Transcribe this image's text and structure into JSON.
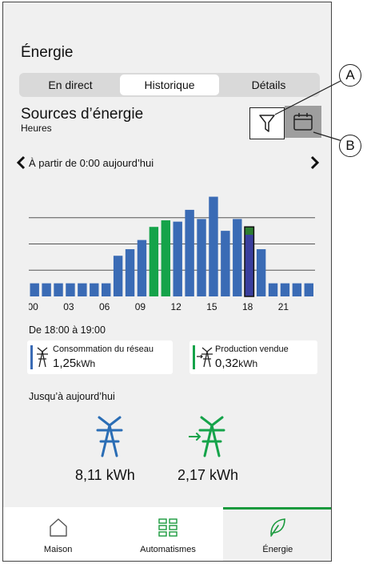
{
  "title": "Énergie",
  "tabs": [
    {
      "label": "En direct",
      "active": false
    },
    {
      "label": "Historique",
      "active": true
    },
    {
      "label": "Détails",
      "active": false
    }
  ],
  "sources": {
    "title": "Sources d’énergie",
    "subtitle": "Heures"
  },
  "toolbar": {
    "filter_icon": "filter-icon",
    "calendar_icon": "calendar-icon"
  },
  "nav": {
    "label": "À partir de 0:00 aujourd’hui"
  },
  "chart_data": {
    "type": "bar",
    "categories": [
      "00",
      "01",
      "02",
      "03",
      "04",
      "05",
      "06",
      "07",
      "08",
      "09",
      "10",
      "11",
      "12",
      "13",
      "14",
      "15",
      "16",
      "17",
      "18",
      "19",
      "20",
      "21",
      "22",
      "23"
    ],
    "tick_labels": [
      "00",
      "03",
      "06",
      "09",
      "12",
      "15",
      "18",
      "21"
    ],
    "series": [
      {
        "color": "#3a6bb5",
        "values": [
          1.0,
          1.0,
          1.0,
          1.0,
          1.0,
          1.0,
          1.0,
          3.1,
          3.6,
          4.3,
          0,
          0,
          5.7,
          6.6,
          5.9,
          7.6,
          5.0,
          5.9,
          5.3,
          3.6,
          1.0,
          1.0,
          1.0,
          1.0
        ]
      },
      {
        "color": "#15a34a",
        "values": [
          0,
          0,
          0,
          0,
          0,
          0,
          0,
          0,
          0,
          0,
          5.3,
          5.8,
          0,
          0,
          0,
          0,
          0,
          0,
          0,
          0,
          0,
          0,
          0,
          0
        ]
      }
    ],
    "highlight": {
      "index": 18,
      "top_color": "#2e7d32",
      "top_value": 0.6,
      "bottom_color": "#3a3f9e"
    },
    "ylim": [
      0,
      8
    ],
    "grid_lines": [
      2,
      4,
      6
    ],
    "grid": true
  },
  "period": "De 18:00 à 19:00",
  "cards": [
    {
      "label": "Consommation du réseau",
      "value": "1,25",
      "unit": "kWh",
      "color": "#3a6bb5",
      "icon": "grid-pylon-icon"
    },
    {
      "label": "Production vendue",
      "value": "0,32",
      "unit": "kWh",
      "color": "#15a34a",
      "icon": "grid-pylon-export-icon"
    }
  ],
  "sofar": "Jusqu’à aujourd’hui",
  "totals": [
    {
      "value": "8,11 kWh",
      "color": "#2a6db5",
      "icon": "grid-pylon-icon"
    },
    {
      "value": "2,17 kWh",
      "color": "#15a34a",
      "icon": "grid-pylon-export-icon"
    }
  ],
  "bottom_nav": [
    {
      "label": "Maison",
      "icon": "house-icon",
      "active": false
    },
    {
      "label": "Automatismes",
      "icon": "grid-apps-icon",
      "active": false
    },
    {
      "label": "Énergie",
      "icon": "leaf-icon",
      "active": true
    }
  ],
  "callouts": {
    "a": "A",
    "b": "B"
  }
}
